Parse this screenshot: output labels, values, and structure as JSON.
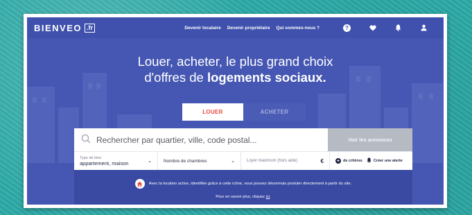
{
  "brand": {
    "name": "BIENVEO",
    "tld": ".fr"
  },
  "nav": {
    "links": [
      "Devenir locataire",
      "Devenir propriétaire",
      "Qui sommes-nous ?"
    ],
    "icons": [
      "help-icon",
      "heart-icon",
      "bell-icon",
      "user-icon"
    ]
  },
  "hero": {
    "line1": "Louer, acheter, le plus grand choix",
    "line2_prefix": "d'offres de ",
    "line2_bold": "logements sociaux."
  },
  "tabs": {
    "rent": "LOUER",
    "buy": "ACHETER",
    "active": "rent"
  },
  "search": {
    "placeholder": "Rechercher par quartier, ville, code postal...",
    "submit": "Voir les annonces"
  },
  "filters": {
    "type_label": "Type de bien",
    "type_value": "appartement, maison",
    "rooms": "Nombre de chambres",
    "rent": "Loyer maximum (hors aide)",
    "currency": "€",
    "more": "de critères",
    "alert": "Créer une alerte"
  },
  "info": {
    "line1": "Avec la location active, identifiée grâce à cette icône, vous pouvez désormais postuler directement à partir du site.",
    "line2_prefix": "Pour en savoir plus, cliquez ",
    "line2_link": "ici",
    "line2_suffix": "."
  },
  "colors": {
    "background_teal": "#2fa9a6",
    "hero_blue": "#4557b3",
    "accent_red": "#e74a3b",
    "button_gray": "#b6bac3"
  }
}
